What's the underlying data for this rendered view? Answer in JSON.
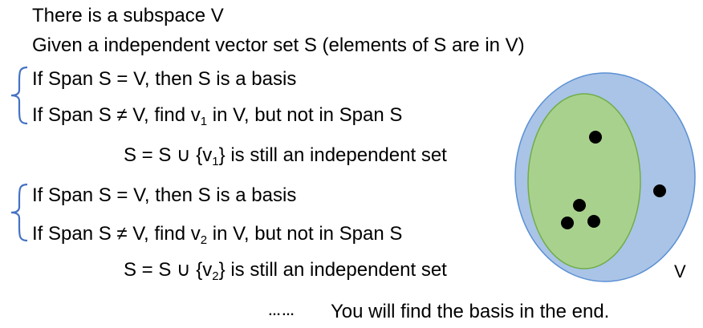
{
  "lines": {
    "intro": "There is a subspace V",
    "given": "Given a independent vector set S (elements of S are in V)",
    "step1_basis": "If Span S = V, then S is a basis",
    "step1_find_pre": "If Span S ≠ V, find v",
    "step1_find_sub": "1",
    "step1_find_post": " in V, but not in Span S",
    "step1_update_pre": "S = S ∪ {v",
    "step1_update_sub": "1",
    "step1_update_post": "} is still an independent set",
    "step2_basis": "If Span S = V, then S is a basis",
    "step2_find_pre": "If Span S ≠ V, find v",
    "step2_find_sub": "2",
    "step2_find_post": " in V, but not in Span S",
    "step2_update_pre": "S = S ∪ {v",
    "step2_update_sub": "2",
    "step2_update_post": "} is still an independent set",
    "ellipsis": "……",
    "conclusion": "You will find the basis in the end."
  },
  "diagram": {
    "outer_label": "V",
    "colors": {
      "outer_fill": "#a9c4e6",
      "outer_stroke": "#5b8fd4",
      "inner_fill": "#a9d18e",
      "inner_stroke": "#70ad47",
      "brace": "#4472c4",
      "dot": "#000000"
    }
  }
}
